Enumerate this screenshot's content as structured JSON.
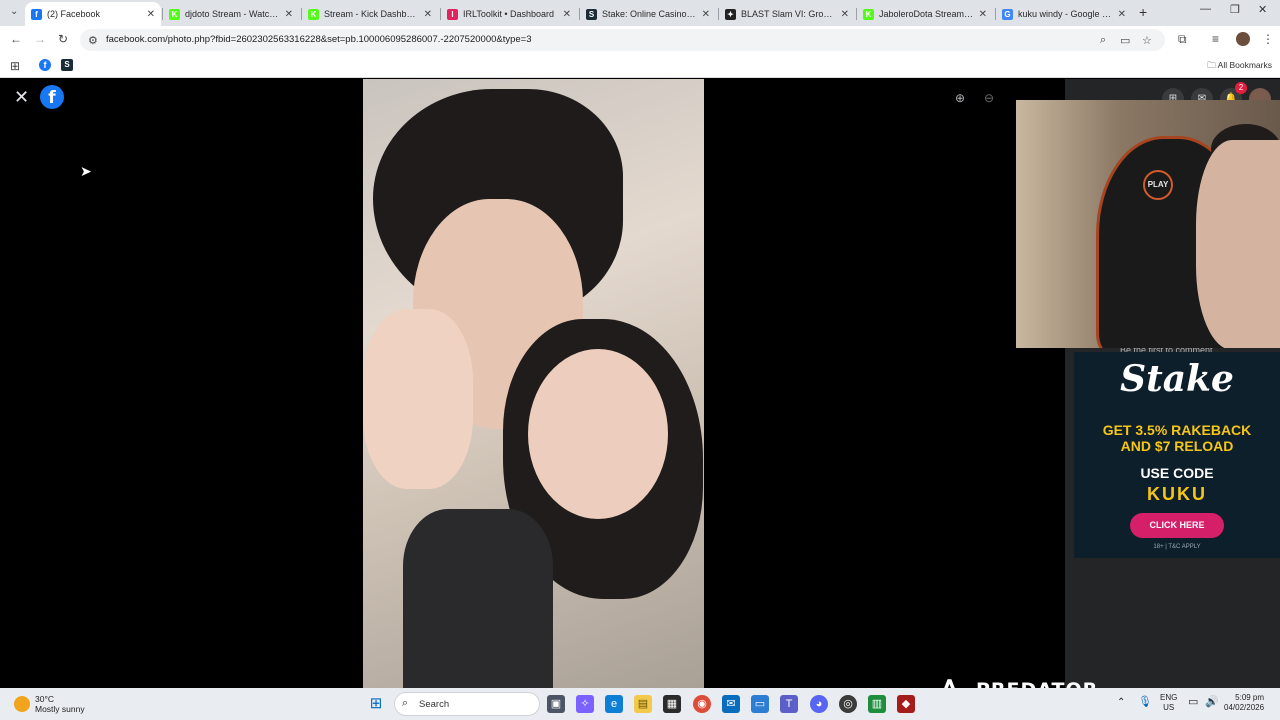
{
  "browser": {
    "tabs": [
      {
        "title": "(2) Facebook",
        "icon": "facebook-icon",
        "color": "#1877f2",
        "glyph": "f"
      },
      {
        "title": "djdoto Stream - Watch Live",
        "icon": "kick-icon",
        "color": "#53fc18",
        "glyph": "K"
      },
      {
        "title": "Stream - Kick Dashboard",
        "icon": "kick-icon",
        "color": "#53fc18",
        "glyph": "K"
      },
      {
        "title": "IRLToolkit • Dashboard",
        "icon": "irltoolkit-icon",
        "color": "#e0245e",
        "glyph": "I"
      },
      {
        "title": "Stake: Online Casino & Sports",
        "icon": "stake-icon",
        "color": "#1a2c38",
        "glyph": "S"
      },
      {
        "title": "BLAST Slam VI: Group Stage",
        "icon": "blast-icon",
        "color": "#222222",
        "glyph": "✦"
      },
      {
        "title": "JaboleroDota Stream - Watch",
        "icon": "kick-icon",
        "color": "#53fc18",
        "glyph": "K"
      },
      {
        "title": "kuku windy - Google Search",
        "icon": "google-icon",
        "color": "#4285f4",
        "glyph": "G"
      }
    ],
    "url": "facebook.com/photo.php?fbid=2602302563316228&set=pb.100006095286007.-2207520000&type=3",
    "bookmarks_label": "All Bookmarks"
  },
  "facebook": {
    "logo_glyph": "f",
    "comment_hint": "Be the first to comment",
    "notification_count": "2"
  },
  "webcam": {
    "chair_logo": "PLAY"
  },
  "ad": {
    "brand": "Stake",
    "headline1": "GET 3.5% RAKEBACK",
    "headline2": "AND $7 RELOAD",
    "code_label": "USE CODE",
    "code": "KUKU",
    "cta": "CLICK HERE",
    "terms": "18+ | T&C APPLY",
    "colors": {
      "bg": "#0e1f2c",
      "headline": "#f5c518",
      "cta": "#d61f69"
    }
  },
  "overlay": {
    "brand": "PREDATOR"
  },
  "taskbar": {
    "weather_temp": "30°C",
    "weather_desc": "Mostly sunny",
    "search_label": "Search",
    "lang": "ENG",
    "region": "US",
    "time": "5:09 pm",
    "date": "04/02/2026"
  }
}
